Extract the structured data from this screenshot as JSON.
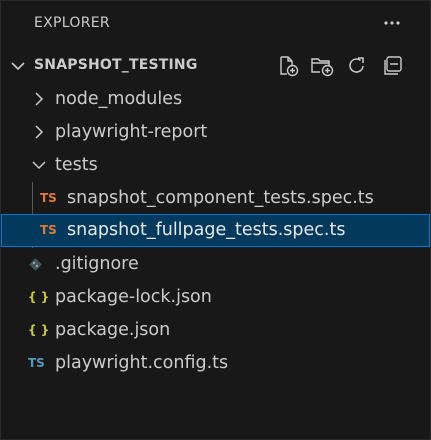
{
  "header": {
    "title": "EXPLORER",
    "more_icon": "ellipsis-icon"
  },
  "section": {
    "title": "SNAPSHOT_TESTING",
    "expanded": true,
    "actions": [
      {
        "name": "new-file-button",
        "icon": "new-file-icon"
      },
      {
        "name": "new-folder-button",
        "icon": "new-folder-icon"
      },
      {
        "name": "refresh-button",
        "icon": "refresh-icon"
      },
      {
        "name": "collapse-all-button",
        "icon": "collapse-all-icon"
      }
    ]
  },
  "tree": {
    "node_modules": {
      "label": "node_modules",
      "type": "folder",
      "expanded": false
    },
    "playwright_report": {
      "label": "playwright-report",
      "type": "folder",
      "expanded": false
    },
    "tests": {
      "label": "tests",
      "type": "folder",
      "expanded": true
    },
    "component_spec": {
      "label": "snapshot_component_tests.spec.ts",
      "type": "ts",
      "icon_text": "TS",
      "icon_color": "#e37933"
    },
    "fullpage_spec": {
      "label": "snapshot_fullpage_tests.spec.ts",
      "type": "ts",
      "icon_text": "TS",
      "icon_color": "#e37933",
      "selected": true
    },
    "gitignore": {
      "label": ".gitignore",
      "type": "git",
      "icon_color": "#41535b"
    },
    "package_lock": {
      "label": "package-lock.json",
      "type": "json",
      "icon_text": "{ }",
      "icon_color": "#cbcb41"
    },
    "package_json": {
      "label": "package.json",
      "type": "json",
      "icon_text": "{ }",
      "icon_color": "#cbcb41"
    },
    "playwright_config": {
      "label": "playwright.config.ts",
      "type": "ts",
      "icon_text": "TS",
      "icon_color": "#519aba"
    }
  }
}
